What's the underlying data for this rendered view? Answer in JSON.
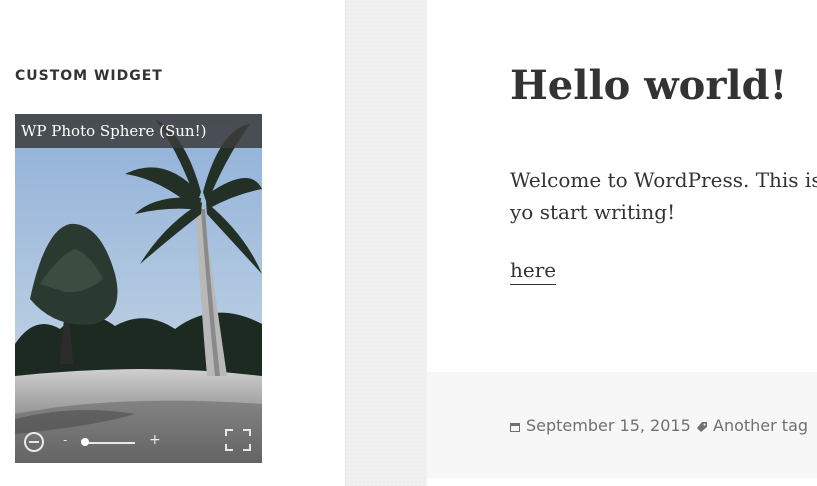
{
  "sidebar": {
    "widget_title": "CUSTOM WIDGET",
    "photo_widget": {
      "caption": "WP Photo Sphere (Sun!)",
      "minus_label": "-",
      "plus_label": "+",
      "zoom_level": 0.0
    }
  },
  "post": {
    "title": "Hello world!",
    "body": "Welcome to WordPress. This is yo start writing!",
    "link_text": "here",
    "date": "September 15, 2015",
    "tag": "Another tag"
  },
  "colors": {
    "text": "#333333",
    "meta_text": "#707070",
    "footer_bg": "#f7f7f7",
    "strip_bg": "#f1f1f1"
  }
}
